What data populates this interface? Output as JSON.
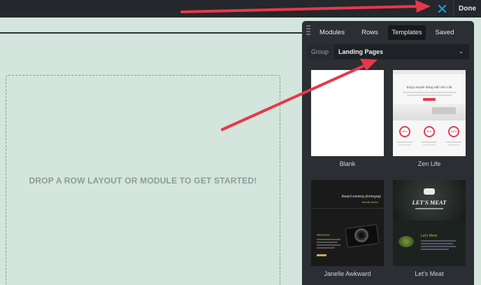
{
  "topbar": {
    "done_label": "Done"
  },
  "dropzone": {
    "text": "DROP A ROW LAYOUT OR MODULE TO GET STARTED!"
  },
  "panel": {
    "tabs": [
      {
        "label": "Modules",
        "active": false
      },
      {
        "label": "Rows",
        "active": false
      },
      {
        "label": "Templates",
        "active": true
      },
      {
        "label": "Saved",
        "active": false
      }
    ],
    "group_label": "Group",
    "group_value": "Landing Pages",
    "templates": [
      {
        "label": "Blank"
      },
      {
        "label": "Zen Life",
        "headline": "Enjoy simple living with Zen Life",
        "stats": [
          "90%",
          "80%",
          "100%"
        ]
      },
      {
        "label": "Janelle Awkward",
        "headline": "Award winning photograp",
        "subline": "Janelle Awkw",
        "caption": "Welcome"
      },
      {
        "label": "Let's Meat",
        "headline": "LET'S MEAT",
        "caption": "Let's Meat"
      }
    ]
  },
  "colors": {
    "accent": "#1e9bd7",
    "arrow": "#e8374a",
    "zen_accent": "#e53950"
  }
}
